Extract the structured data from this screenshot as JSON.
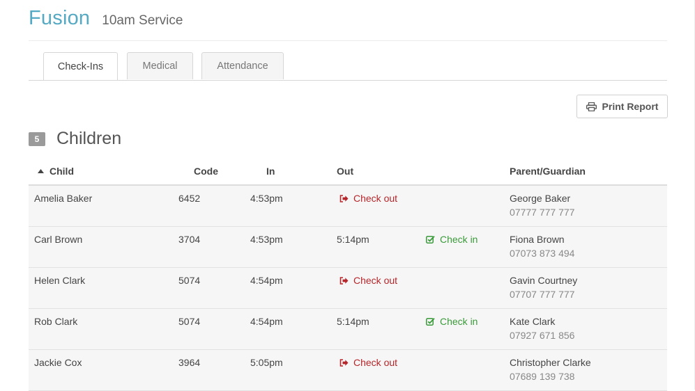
{
  "header": {
    "brand": "Fusion",
    "service": "10am Service"
  },
  "tabs": [
    {
      "label": "Check-Ins",
      "active": true
    },
    {
      "label": "Medical",
      "active": false
    },
    {
      "label": "Attendance",
      "active": false
    }
  ],
  "toolbar": {
    "print_label": "Print Report",
    "print_icon": "printer-icon"
  },
  "section": {
    "count": "5",
    "title": "Children"
  },
  "table": {
    "sort_icon": "sort-ascending-icon",
    "columns": {
      "child": "Child",
      "code": "Code",
      "in": "In",
      "out": "Out",
      "parent": "Parent/Guardian"
    },
    "rows": [
      {
        "child": "Amelia Baker",
        "code": "6452",
        "in": "4:53pm",
        "out": "",
        "action": "Check out",
        "action_type": "out",
        "parent": "George Baker",
        "phone": "07777 777 777"
      },
      {
        "child": "Carl Brown",
        "code": "3704",
        "in": "4:53pm",
        "out": "5:14pm",
        "action": "Check in",
        "action_type": "in",
        "parent": "Fiona Brown",
        "phone": "07073 873 494"
      },
      {
        "child": "Helen Clark",
        "code": "5074",
        "in": "4:54pm",
        "out": "",
        "action": "Check out",
        "action_type": "out",
        "parent": "Gavin Courtney",
        "phone": "07707 777 777"
      },
      {
        "child": "Rob Clark",
        "code": "5074",
        "in": "4:54pm",
        "out": "5:14pm",
        "action": "Check in",
        "action_type": "in",
        "parent": "Kate Clark",
        "phone": "07927 671 856"
      },
      {
        "child": "Jackie Cox",
        "code": "3964",
        "in": "5:05pm",
        "out": "",
        "action": "Check out",
        "action_type": "out",
        "parent": "Christopher Clarke",
        "phone": "07689 139 738"
      }
    ]
  },
  "colors": {
    "brand": "#55a9c2",
    "check_out": "#b5262a",
    "check_in": "#3a9a3a",
    "badge": "#9a9a9a"
  }
}
